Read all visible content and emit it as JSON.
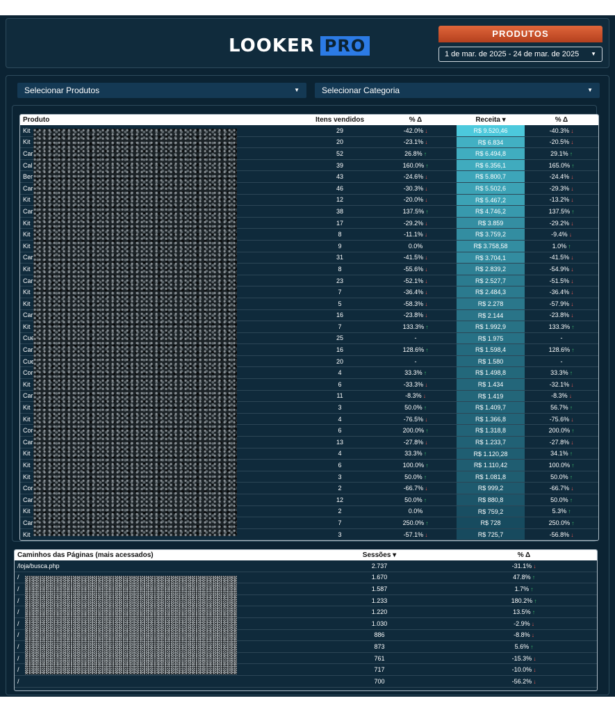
{
  "header": {
    "logo_main": "LOOKER",
    "logo_pro": "PRO",
    "badge": "PRODUTOS",
    "date_range": "1 de mar. de 2025 - 24 de mar. de 2025"
  },
  "filters": {
    "products": "Selecionar Produtos",
    "category": "Selecionar Categoria"
  },
  "products_table": {
    "headers": [
      "Produto",
      "Itens vendidos",
      "% Δ",
      "Receita ▾",
      "% Δ"
    ],
    "rows": [
      {
        "p": "Kit",
        "i": "29",
        "d": "-42.0%",
        "r": "R$ 9.520,46",
        "d2": "-40.3%"
      },
      {
        "p": "Kit",
        "i": "20",
        "d": "-23.1%",
        "r": "R$ 6.834",
        "d2": "-20.5%"
      },
      {
        "p": "Car",
        "i": "52",
        "d": "26.8%",
        "r": "R$ 6.494,8",
        "d2": "29.1%"
      },
      {
        "p": "Cal",
        "i": "39",
        "d": "160.0%",
        "r": "R$ 6.356,1",
        "d2": "165.0%"
      },
      {
        "p": "Ber",
        "i": "43",
        "d": "-24.6%",
        "r": "R$ 5.800,7",
        "d2": "-24.4%"
      },
      {
        "p": "Car",
        "i": "46",
        "d": "-30.3%",
        "r": "R$ 5.502,6",
        "d2": "-29.3%"
      },
      {
        "p": "Kit",
        "i": "12",
        "d": "-20.0%",
        "r": "R$ 5.467,2",
        "d2": "-13.2%"
      },
      {
        "p": "Car",
        "i": "38",
        "d": "137.5%",
        "r": "R$ 4.746,2",
        "d2": "137.5%"
      },
      {
        "p": "Kit",
        "i": "17",
        "d": "-29.2%",
        "r": "R$ 3.859",
        "d2": "-29.2%"
      },
      {
        "p": "Kit",
        "i": "8",
        "d": "-11.1%",
        "r": "R$ 3.759,2",
        "d2": "-9.4%"
      },
      {
        "p": "Kit",
        "i": "9",
        "d": "0.0%",
        "r": "R$ 3.758,58",
        "d2": "1.0%"
      },
      {
        "p": "Car",
        "i": "31",
        "d": "-41.5%",
        "r": "R$ 3.704,1",
        "d2": "-41.5%"
      },
      {
        "p": "Kit",
        "i": "8",
        "d": "-55.6%",
        "r": "R$ 2.839,2",
        "d2": "-54.9%"
      },
      {
        "p": "Car",
        "i": "23",
        "d": "-52.1%",
        "r": "R$ 2.527,7",
        "d2": "-51.5%"
      },
      {
        "p": "Kit",
        "i": "7",
        "d": "-36.4%",
        "r": "R$ 2.484,3",
        "d2": "-36.4%"
      },
      {
        "p": "Kit",
        "i": "5",
        "d": "-58.3%",
        "r": "R$ 2.278",
        "d2": "-57.9%"
      },
      {
        "p": "Car",
        "i": "16",
        "d": "-23.8%",
        "r": "R$ 2.144",
        "d2": "-23.8%"
      },
      {
        "p": "Kit",
        "i": "7",
        "d": "133.3%",
        "r": "R$ 1.992,9",
        "d2": "133.3%"
      },
      {
        "p": "Cue",
        "i": "25",
        "d": "-",
        "r": "R$ 1.975",
        "d2": "-"
      },
      {
        "p": "Car",
        "i": "16",
        "d": "128.6%",
        "r": "R$ 1.598,4",
        "d2": "128.6%"
      },
      {
        "p": "Cue",
        "i": "20",
        "d": "-",
        "r": "R$ 1.580",
        "d2": "-"
      },
      {
        "p": "Cor",
        "i": "4",
        "d": "33.3%",
        "r": "R$ 1.498,8",
        "d2": "33.3%"
      },
      {
        "p": "Kit",
        "i": "6",
        "d": "-33.3%",
        "r": "R$ 1.434",
        "d2": "-32.1%"
      },
      {
        "p": "Car",
        "i": "11",
        "d": "-8.3%",
        "r": "R$ 1.419",
        "d2": "-8.3%"
      },
      {
        "p": "Kit",
        "i": "3",
        "d": "50.0%",
        "r": "R$ 1.409,7",
        "d2": "56.7%"
      },
      {
        "p": "Kit",
        "i": "4",
        "d": "-76.5%",
        "r": "R$ 1.366,8",
        "d2": "-75.6%"
      },
      {
        "p": "Cor",
        "i": "6",
        "d": "200.0%",
        "r": "R$ 1.318,8",
        "d2": "200.0%"
      },
      {
        "p": "Car",
        "i": "13",
        "d": "-27.8%",
        "r": "R$ 1.233,7",
        "d2": "-27.8%"
      },
      {
        "p": "Kit",
        "i": "4",
        "d": "33.3%",
        "r": "R$ 1.120,28",
        "d2": "34.1%"
      },
      {
        "p": "Kit",
        "i": "6",
        "d": "100.0%",
        "r": "R$ 1.110,42",
        "d2": "100.0%"
      },
      {
        "p": "Kit",
        "i": "3",
        "d": "50.0%",
        "r": "R$ 1.081,8",
        "d2": "50.0%"
      },
      {
        "p": "Cor",
        "i": "2",
        "d": "-66.7%",
        "r": "R$ 999,2",
        "d2": "-66.7%"
      },
      {
        "p": "Car",
        "i": "12",
        "d": "50.0%",
        "r": "R$ 880,8",
        "d2": "50.0%"
      },
      {
        "p": "Kit",
        "i": "2",
        "d": "0.0%",
        "r": "R$ 759,2",
        "d2": "5.3%"
      },
      {
        "p": "Car",
        "i": "7",
        "d": "250.0%",
        "r": "R$ 728",
        "d2": "250.0%"
      },
      {
        "p": "Kit",
        "i": "3",
        "d": "-57.1%",
        "r": "R$ 725,7",
        "d2": "-56.8%"
      }
    ]
  },
  "pages_table": {
    "headers": [
      "Caminhos das Páginas (mais acessados)",
      "Sessões ▾",
      "% Δ"
    ],
    "rows": [
      {
        "p": "/loja/busca.php",
        "s": "2.737",
        "d": "-31.1%"
      },
      {
        "p": "/",
        "s": "1.670",
        "d": "47.8%"
      },
      {
        "p": "/",
        "s": "1.587",
        "d": "1.7%"
      },
      {
        "p": "/",
        "s": "1.233",
        "d": "180.2%"
      },
      {
        "p": "/",
        "s": "1.220",
        "d": "13.5%"
      },
      {
        "p": "/",
        "s": "1.030",
        "d": "-2.9%"
      },
      {
        "p": "/",
        "s": "886",
        "d": "-8.8%"
      },
      {
        "p": "/",
        "s": "873",
        "d": "5.6%"
      },
      {
        "p": "/",
        "s": "761",
        "d": "-15.3%"
      },
      {
        "p": "/",
        "s": "717",
        "d": "-10.0%"
      },
      {
        "p": "/",
        "s": "700",
        "d": "-56.2%"
      }
    ]
  },
  "colors": {
    "background": "#0b2333",
    "accent_orange": "#e0663a",
    "logo_blue": "#2c7be5",
    "up": "#3ec46d",
    "down": "#f25c54",
    "heat_max": "#4cc9dc",
    "heat_min": "#174a5e"
  }
}
